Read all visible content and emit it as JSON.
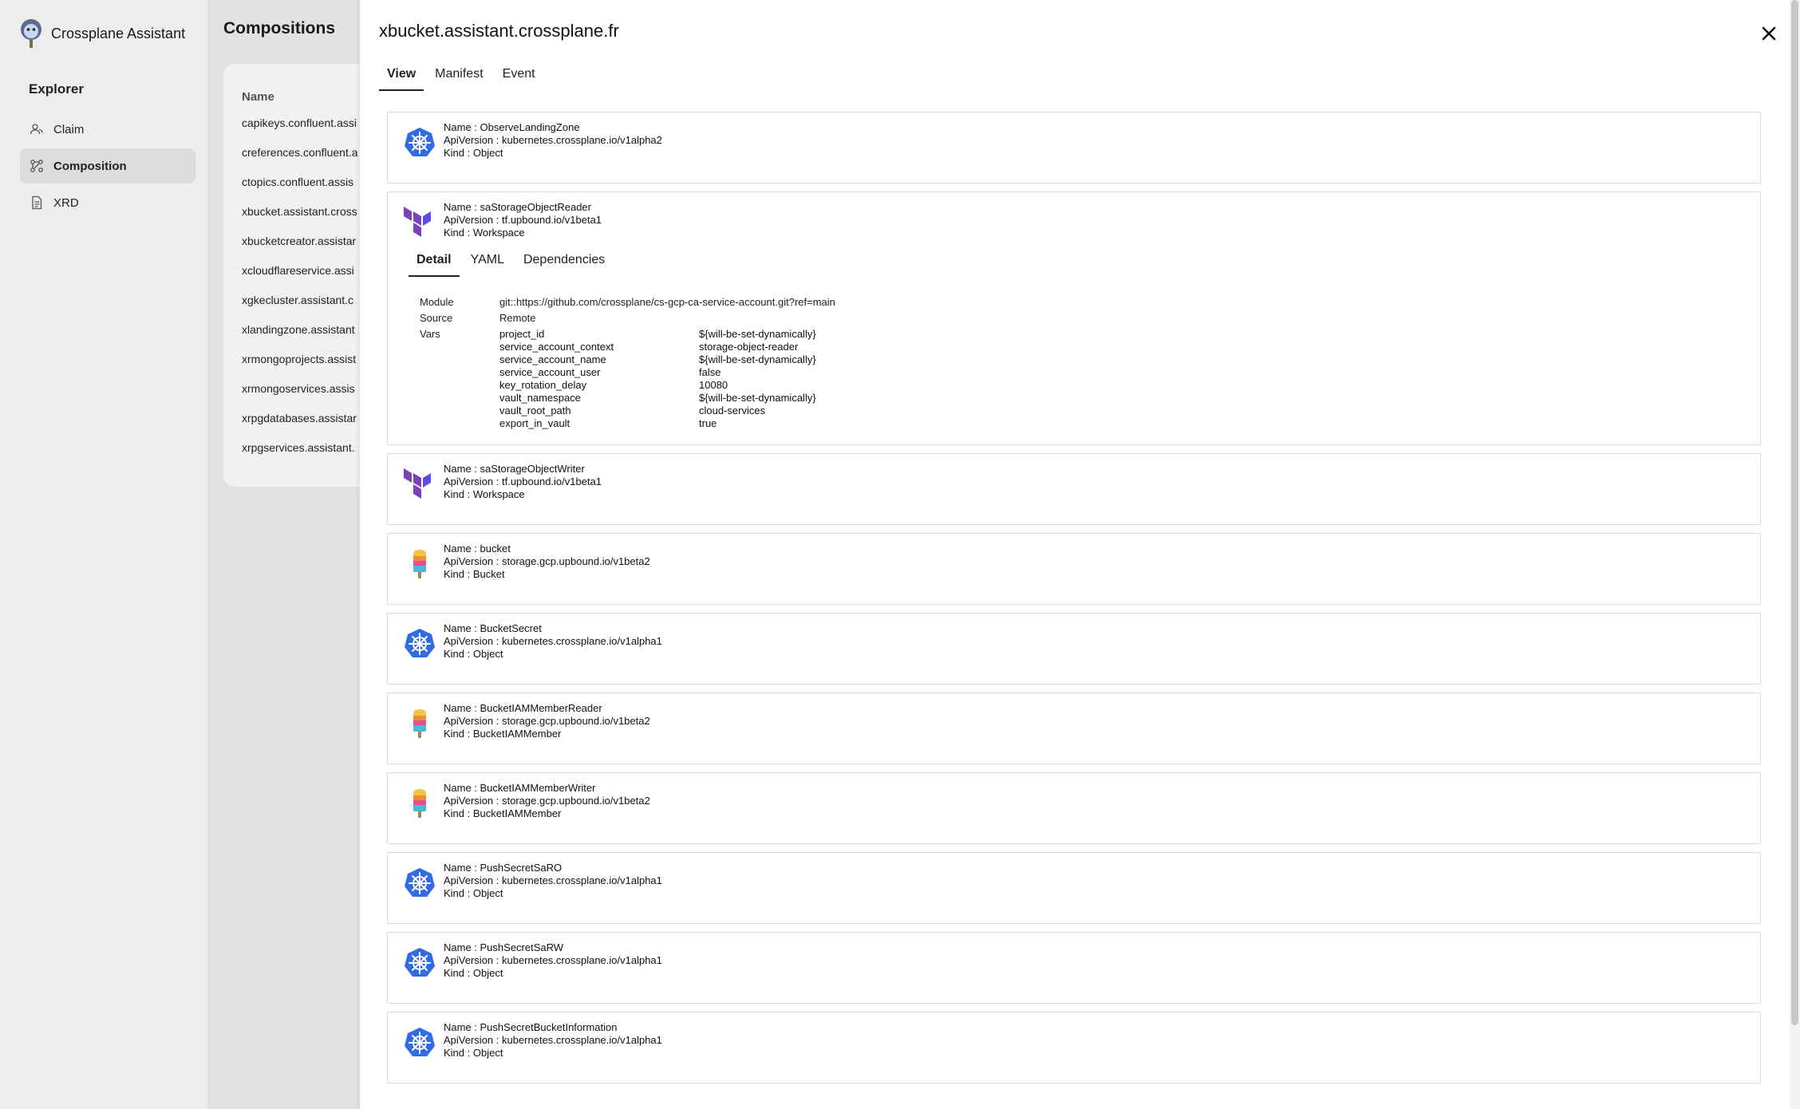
{
  "app": {
    "title": "Crossplane Assistant"
  },
  "sidebar": {
    "section_title": "Explorer",
    "items": [
      {
        "label": "Claim",
        "icon": "users-icon",
        "active": false
      },
      {
        "label": "Composition",
        "icon": "graph-icon",
        "active": true
      },
      {
        "label": "XRD",
        "icon": "document-icon",
        "active": false
      }
    ]
  },
  "compositions": {
    "title": "Compositions",
    "column": "Name",
    "rows": [
      "capikeys.confluent.assi",
      "creferences.confluent.a",
      "ctopics.confluent.assis",
      "xbucket.assistant.cross",
      "xbucketcreator.assistar",
      "xcloudflareservice.assi",
      "xgkecluster.assistant.c",
      "xlandingzone.assistant",
      "xrmongoprojects.assist",
      "xrmongoservices.assis",
      "xrpgdatabases.assistar",
      "xrpgservices.assistant."
    ]
  },
  "drawer": {
    "title": "xbucket.assistant.crossplane.fr",
    "tabs": [
      "View",
      "Manifest",
      "Event"
    ],
    "resources": [
      {
        "name": "Name : ObserveLandingZone",
        "api": "ApiVersion : kubernetes.crossplane.io/v1alpha2",
        "kind": "Kind : Object",
        "icon": "kubernetes-icon"
      },
      {
        "name": "Name : saStorageObjectReader",
        "api": "ApiVersion : tf.upbound.io/v1beta1",
        "kind": "Kind : Workspace",
        "icon": "terraform-icon"
      },
      {
        "name": "Name : saStorageObjectWriter",
        "api": "ApiVersion : tf.upbound.io/v1beta1",
        "kind": "Kind : Workspace",
        "icon": "terraform-icon"
      },
      {
        "name": "Name : bucket",
        "api": "ApiVersion : storage.gcp.upbound.io/v1beta2",
        "kind": "Kind : Bucket",
        "icon": "popsicle-icon"
      },
      {
        "name": "Name : BucketSecret",
        "api": "ApiVersion : kubernetes.crossplane.io/v1alpha1",
        "kind": "Kind : Object",
        "icon": "kubernetes-icon"
      },
      {
        "name": "Name : BucketIAMMemberReader",
        "api": "ApiVersion : storage.gcp.upbound.io/v1beta2",
        "kind": "Kind : BucketIAMMember",
        "icon": "popsicle-icon"
      },
      {
        "name": "Name : BucketIAMMemberWriter",
        "api": "ApiVersion : storage.gcp.upbound.io/v1beta2",
        "kind": "Kind : BucketIAMMember",
        "icon": "popsicle-icon"
      },
      {
        "name": "Name : PushSecretSaRO",
        "api": "ApiVersion : kubernetes.crossplane.io/v1alpha1",
        "kind": "Kind : Object",
        "icon": "kubernetes-icon"
      },
      {
        "name": "Name : PushSecretSaRW",
        "api": "ApiVersion : kubernetes.crossplane.io/v1alpha1",
        "kind": "Kind : Object",
        "icon": "kubernetes-icon"
      },
      {
        "name": "Name : PushSecretBucketInformation",
        "api": "ApiVersion : kubernetes.crossplane.io/v1alpha1",
        "kind": "Kind : Object",
        "icon": "kubernetes-icon"
      }
    ],
    "detail": {
      "tabs": [
        "Detail",
        "YAML",
        "Dependencies"
      ],
      "module_label": "Module",
      "module_value": "git::https://github.com/crossplane/cs-gcp-ca-service-account.git?ref=main",
      "source_label": "Source",
      "source_value": "Remote",
      "vars_label": "Vars",
      "vars": [
        {
          "k": "project_id",
          "v": "${will-be-set-dynamically}"
        },
        {
          "k": "service_account_context",
          "v": "storage-object-reader"
        },
        {
          "k": "service_account_name",
          "v": "${will-be-set-dynamically}"
        },
        {
          "k": "service_account_user",
          "v": "false"
        },
        {
          "k": "key_rotation_delay",
          "v": "10080"
        },
        {
          "k": "vault_namespace",
          "v": "${will-be-set-dynamically}"
        },
        {
          "k": "vault_root_path",
          "v": "cloud-services"
        },
        {
          "k": "export_in_vault",
          "v": "true"
        }
      ]
    }
  },
  "colors": {
    "kubernetes": "#326ce5",
    "terraform": "#7b42bc",
    "accent": "#222222"
  }
}
